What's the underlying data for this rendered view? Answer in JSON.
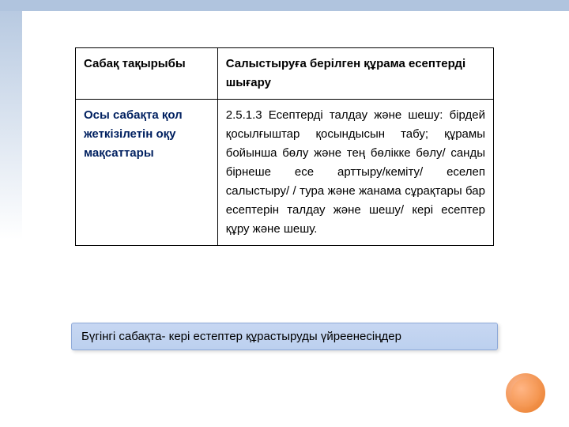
{
  "table": {
    "rows": [
      {
        "label": "Сабақ тақырыбы",
        "value": "Салыстыруға берілген құрама есептерді шығару"
      },
      {
        "label": "Осы сабақта қол жеткізілетін оқу мақсаттары",
        "value": "2.5.1.3 Есептерді талдау және шешу: бірдей қосылғыштар қосындысын табу; құрамы бойынша бөлу және тең бөлікке бөлу/ санды бірнеше есе арттыру/кеміту/ еселеп салыстыру/ / тура және жанама сұрақтары бар  есептерін талдау және шешу/ кері есептер құру және шешу."
      }
    ]
  },
  "callout": {
    "text": "Бүгінгі сабақта- кері естептер құрастыруды үйреенесіңдер"
  },
  "icons": {
    "corner_circle": "decorative-circle"
  }
}
